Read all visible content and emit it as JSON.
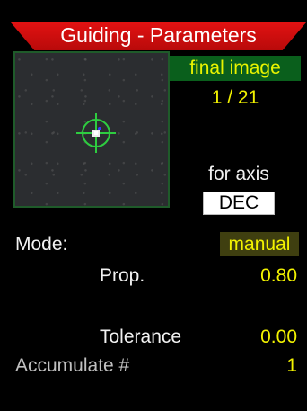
{
  "title": "Guiding - Parameters",
  "preview": {
    "badge": "final image",
    "counter": "1 / 21"
  },
  "axis": {
    "label": "for axis",
    "value": "DEC"
  },
  "mode": {
    "label": "Mode:",
    "value": "manual"
  },
  "prop": {
    "label": "Prop.",
    "value": "0.80"
  },
  "tolerance": {
    "label": "Tolerance",
    "value": "0.00"
  },
  "accumulate": {
    "label": "Accumulate #",
    "value": "1"
  },
  "colors": {
    "title_bar": "#d10f0f",
    "badge_bg": "#0a5f1c",
    "highlight_text": "#f2f200",
    "reticle": "#2ecc40"
  },
  "icons": {
    "reticle": "crosshair-icon"
  }
}
